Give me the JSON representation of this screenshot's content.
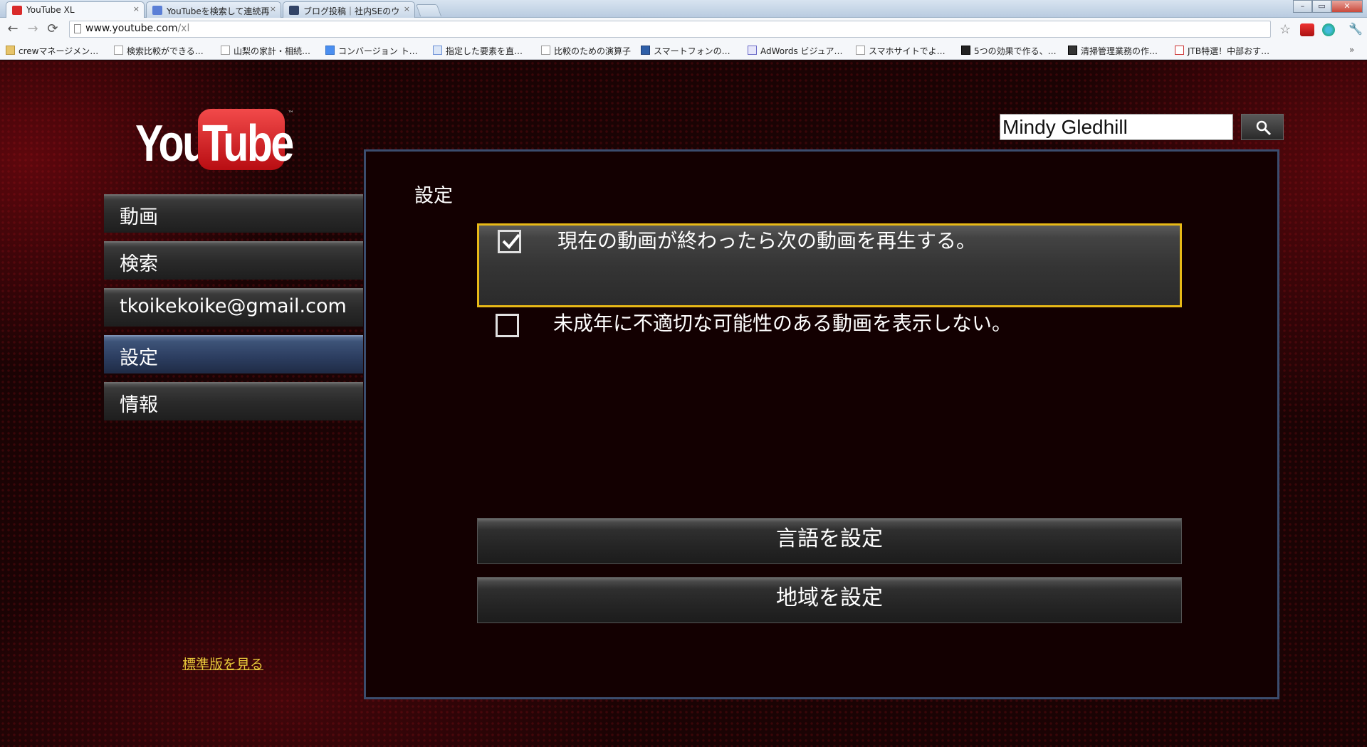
{
  "browser": {
    "tabs": [
      {
        "title": "YouTube XL",
        "favicon_color": "#d92b2b",
        "active": true
      },
      {
        "title": "YouTubeを検索して連続再",
        "favicon_color": "#5b7fd6",
        "active": false
      },
      {
        "title": "ブログ投稿｜社内SEのウ",
        "favicon_color": "#334466",
        "active": false
      }
    ],
    "url_host": "www.youtube.com",
    "url_path": "/xl",
    "bookmarks": [
      {
        "label": "crewマネージメン…",
        "icon": "folder-icon"
      },
      {
        "label": "検索比較ができる…",
        "icon": "page-icon"
      },
      {
        "label": "山梨の家計・相続…",
        "icon": "page-icon"
      },
      {
        "label": "コンバージョン ト…",
        "icon": "google-icon"
      },
      {
        "label": "指定した要素を直…",
        "icon": "ps-icon"
      },
      {
        "label": "比較のための演算子",
        "icon": "page-icon"
      },
      {
        "label": "スマートフォンの…",
        "icon": "s-icon"
      },
      {
        "label": "AdWords ビジュア…",
        "icon": "adwords-icon"
      },
      {
        "label": "スマホサイトでよ…",
        "icon": "page-icon"
      },
      {
        "label": "5つの効果で作る、…",
        "icon": "tas-icon"
      },
      {
        "label": "清掃管理業務の作…",
        "icon": "b-icon"
      },
      {
        "label": "JTB特選！中部おす…",
        "icon": "jtb-icon"
      }
    ]
  },
  "youtube": {
    "logo_you": "You",
    "logo_tube": "Tube",
    "logo_tm": "™",
    "search_value": "Mindy Gledhill",
    "nav": [
      {
        "label": "動画",
        "active": false
      },
      {
        "label": "検索",
        "active": false
      },
      {
        "label": "tkoikekoike@gmail.com",
        "active": false
      },
      {
        "label": "設定",
        "active": true
      },
      {
        "label": "情報",
        "active": false
      }
    ],
    "standard_link": "標準版を見る",
    "settings": {
      "title": "設定",
      "options": [
        {
          "label": "現在の動画が終わったら次の動画を再生する。",
          "checked": true
        },
        {
          "label": "未成年に不適切な可能性のある動画を表示しない。",
          "checked": false
        }
      ],
      "language_button": "言語を設定",
      "region_button": "地域を設定"
    },
    "colors": {
      "accent_border": "#e8b917",
      "panel_border": "#3b4d6e",
      "active_nav": "#3d5378"
    }
  }
}
